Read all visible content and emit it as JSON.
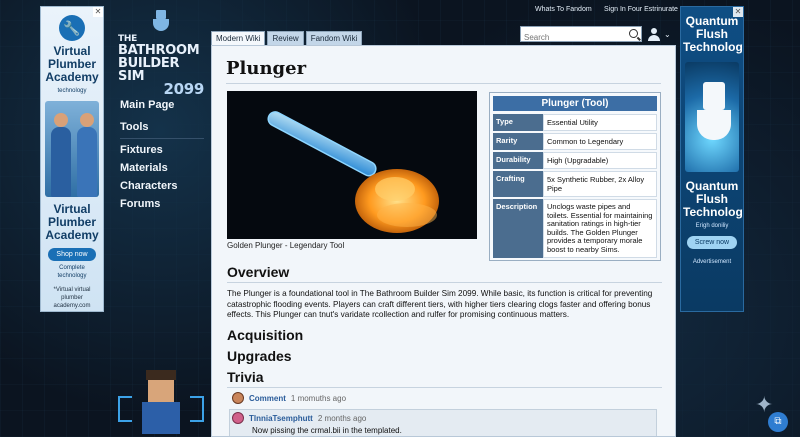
{
  "ads": {
    "left": {
      "logo_icon": "wrench-icon",
      "title_top": "Virtual Plumber Academy",
      "subtitle_top": "technology",
      "title_bottom": "Virtual Plumber Academy",
      "button": "Shop now",
      "subtitle_bottom": "Complete technology",
      "footer": "*Virtual virtual plumber academy.com"
    },
    "right": {
      "title_top": "Quantum Flush Technology",
      "title_bottom": "Quantum Flush Technology",
      "subtitle": "Erigh doniliy",
      "button": "Screw now",
      "advertisement": "Advertisement"
    }
  },
  "logo": {
    "line1": "THE",
    "line2": "BATHROOM",
    "line3": "BUILDER SIM",
    "number": "2099"
  },
  "sidenav": {
    "main_page": "Main Page",
    "tools": "Tools",
    "fixtures": "Fixtures",
    "materials": "Materials",
    "characters": "Characters",
    "forums": "Forums"
  },
  "topbar": {
    "welcome": "Whats To Fandom",
    "signin": "Sign In Four Estrinurate"
  },
  "search": {
    "placeholder": "Search"
  },
  "tabs": [
    "Modern Wiki",
    "Review",
    "Fandom Wiki"
  ],
  "page": {
    "title": "Plunger",
    "caption": "Golden Plunger - Legendary Tool",
    "infobox": {
      "title": "Plunger (Tool)",
      "rows": [
        {
          "key": "Type",
          "value": "Essential Utility"
        },
        {
          "key": "Rarity",
          "value": "Common to Legendary"
        },
        {
          "key": "Durability",
          "value": "High (Upgradable)"
        },
        {
          "key": "Crafting",
          "value": "5x Synthetic Rubber, 2x Alloy Pipe"
        },
        {
          "key": "Description",
          "value": "Unclogs waste pipes and toilets. Essential for maintaining sanitation ratings in high-tier builds. The Golden Plunger provides a temporary morale boost to nearby Sims."
        }
      ]
    },
    "overview_heading": "Overview",
    "overview_text": "The Plunger is a foundational tool in The Bathroom Builder Sim 2099. While basic, its function is critical for preventing catastrophic flooding events. Players can craft different tiers, with higher tiers clearing clogs faster and offering bonus effects. This Plunger can tnut's varidate rcollection and rulfer for promising continuous matters.",
    "acquisition_heading": "Acquisition",
    "upgrades_heading": "Upgrades",
    "trivia_heading": "Trivia"
  },
  "comments": [
    {
      "name": "Comment",
      "time": "1 momuths ago"
    },
    {
      "name": "TlnniaTsemphutt",
      "time": "2 months ago",
      "text": "Now pissing the crmal.bii in the templated."
    }
  ],
  "colors": {
    "accent": "#3c6ea5",
    "background": "#0b1420",
    "panel": "#f2f6fa"
  }
}
